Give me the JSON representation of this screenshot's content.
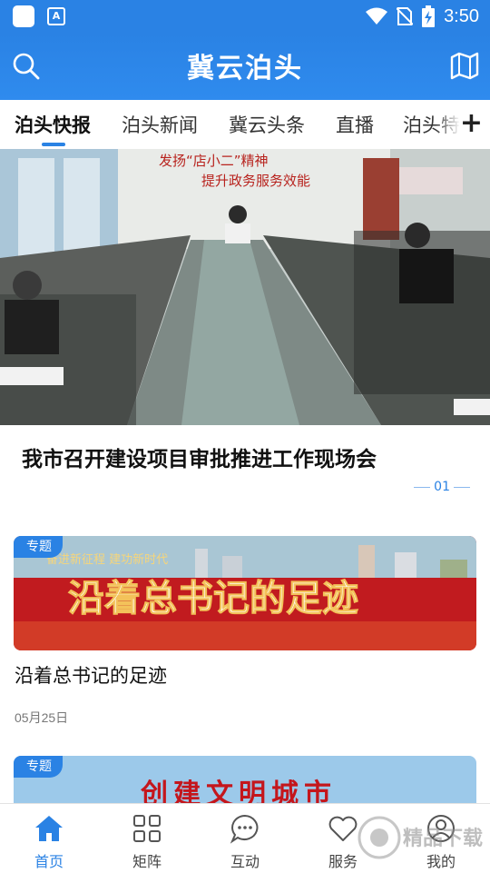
{
  "status_bar": {
    "time": "3:50",
    "left_icon_letter": "A"
  },
  "header": {
    "title": "冀云泊头",
    "left_icon": "search-icon",
    "right_icon": "map-icon"
  },
  "tabs": [
    {
      "label": "泊头快报",
      "active": true
    },
    {
      "label": "泊头新闻"
    },
    {
      "label": "冀云头条"
    },
    {
      "label": "直播"
    },
    {
      "label": "泊头特"
    }
  ],
  "add_tab_symbol": "+",
  "banner": {
    "title": "我市召开建设项目审批推进工作现场会",
    "page_indicator": "01",
    "photo_slogan_1": "发扬“店小二”精神",
    "photo_slogan_2": "提升政务服务效能"
  },
  "cards": [
    {
      "tag": "专题",
      "image_text": "沿着总书记的足迹",
      "image_subtext": "奋进新征程 建功新时代",
      "title": "沿着总书记的足迹",
      "date": "05月25日"
    },
    {
      "tag": "专题",
      "image_text": "创建文明城市"
    }
  ],
  "bottom_nav": [
    {
      "label": "首页",
      "icon": "home-icon",
      "active": true
    },
    {
      "label": "矩阵",
      "icon": "grid-icon"
    },
    {
      "label": "互动",
      "icon": "chat-icon"
    },
    {
      "label": "服务",
      "icon": "heart-icon"
    },
    {
      "label": "我的",
      "icon": "user-icon"
    }
  ],
  "watermark": {
    "text": "精品下载"
  },
  "colors": {
    "brand": "#2a82e4",
    "red_banner": "#c4161c"
  }
}
